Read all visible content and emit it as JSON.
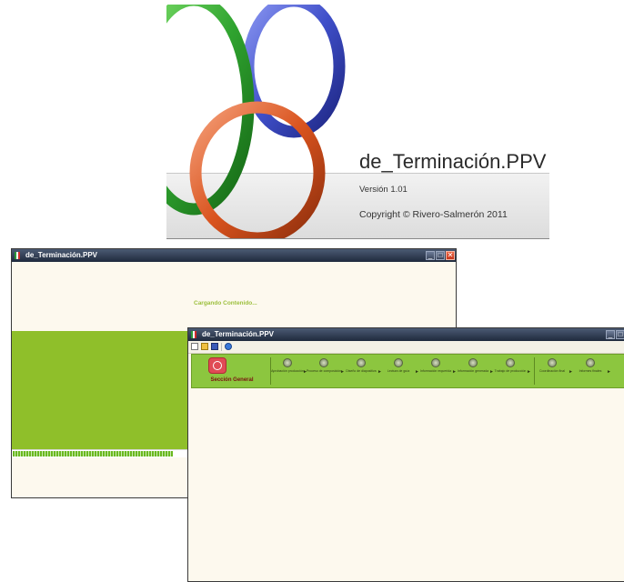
{
  "splash": {
    "app_title": "de_Terminación.PPV",
    "version": "Versión 1.01",
    "copyright": "Copyright © Rivero-Salmerón 2011",
    "ring_colors": {
      "green": "#2fa32f",
      "blue": "#3f4fc9",
      "orange": "#d9531e"
    }
  },
  "loading_window": {
    "title": "de_Terminación.PPV",
    "message": "Cargando Contenido...",
    "progress": 0.36,
    "accent_color": "#8fbf2a"
  },
  "main_window": {
    "title": "de_Terminación.PPV",
    "toolbar_icons": [
      "new-file-icon",
      "open-folder-icon",
      "save-icon",
      "help-icon"
    ],
    "section_label": "Sección General",
    "stages": [
      {
        "label": "Aprobación producción"
      },
      {
        "label": "Proceso de composición"
      },
      {
        "label": "Diseño de diapositiva"
      },
      {
        "label": "Lectura de guía"
      },
      {
        "label": "Información requerida"
      },
      {
        "label": "Información generada"
      },
      {
        "label": "Trabajo de producción"
      },
      {
        "label": "Coordinación final"
      },
      {
        "label": "Informes finales"
      }
    ],
    "ribbon_color": "#8cc63f"
  }
}
